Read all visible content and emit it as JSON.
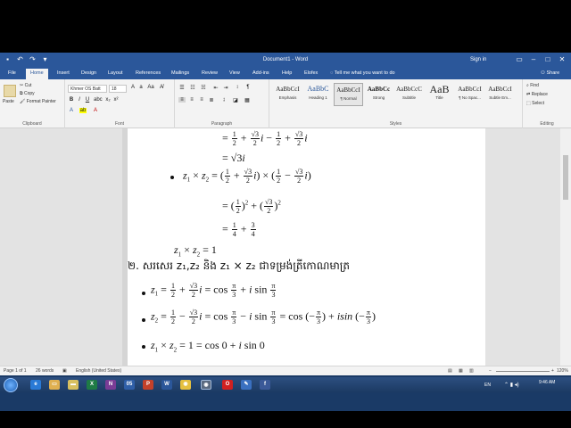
{
  "titlebar": {
    "title": "Document1 - Word",
    "signin": "Sign in"
  },
  "tabs": [
    "File",
    "Home",
    "Insert",
    "Design",
    "Layout",
    "References",
    "Mailings",
    "Review",
    "View",
    "Add-ins",
    "Help",
    "Elofex"
  ],
  "tellme": "Tell me what you want to do",
  "share": "Share",
  "clipboard": {
    "paste": "Paste",
    "cut": "Cut",
    "copy": "Copy",
    "format_painter": "Format Painter",
    "label": "Clipboard"
  },
  "font": {
    "name": "Khmer OS Batt",
    "size": "18",
    "label": "Font"
  },
  "paragraph": {
    "label": "Paragraph"
  },
  "styles": {
    "label": "Styles",
    "items": [
      {
        "sample": "AaBbCcI",
        "name": "Emphasis"
      },
      {
        "sample": "AaBbC",
        "name": "Heading 1"
      },
      {
        "sample": "AaBbCcI",
        "name": "¶ Normal"
      },
      {
        "sample": "AaBbCc",
        "name": "Strong"
      },
      {
        "sample": "AaBbCcC",
        "name": "Subtitle"
      },
      {
        "sample": "AaB",
        "name": "Title"
      },
      {
        "sample": "AaBbCcI",
        "name": "¶ No Spac..."
      },
      {
        "sample": "AaBbCcI",
        "name": "Subtle Em..."
      }
    ]
  },
  "editing": {
    "find": "Find",
    "replace": "Replace",
    "select": "Select",
    "label": "Editing"
  },
  "document": {
    "heading": "២. សរសេរ z₁,z₂ និង z₁ × z₂ ជាទម្រង់ត្រីកោណមាត្រ"
  },
  "status": {
    "page": "Page 1 of 1",
    "words": "26 words",
    "language": "English (United States)",
    "zoom": "120%"
  },
  "taskbar": {
    "lang": "EN",
    "time": "9:46 AM"
  }
}
